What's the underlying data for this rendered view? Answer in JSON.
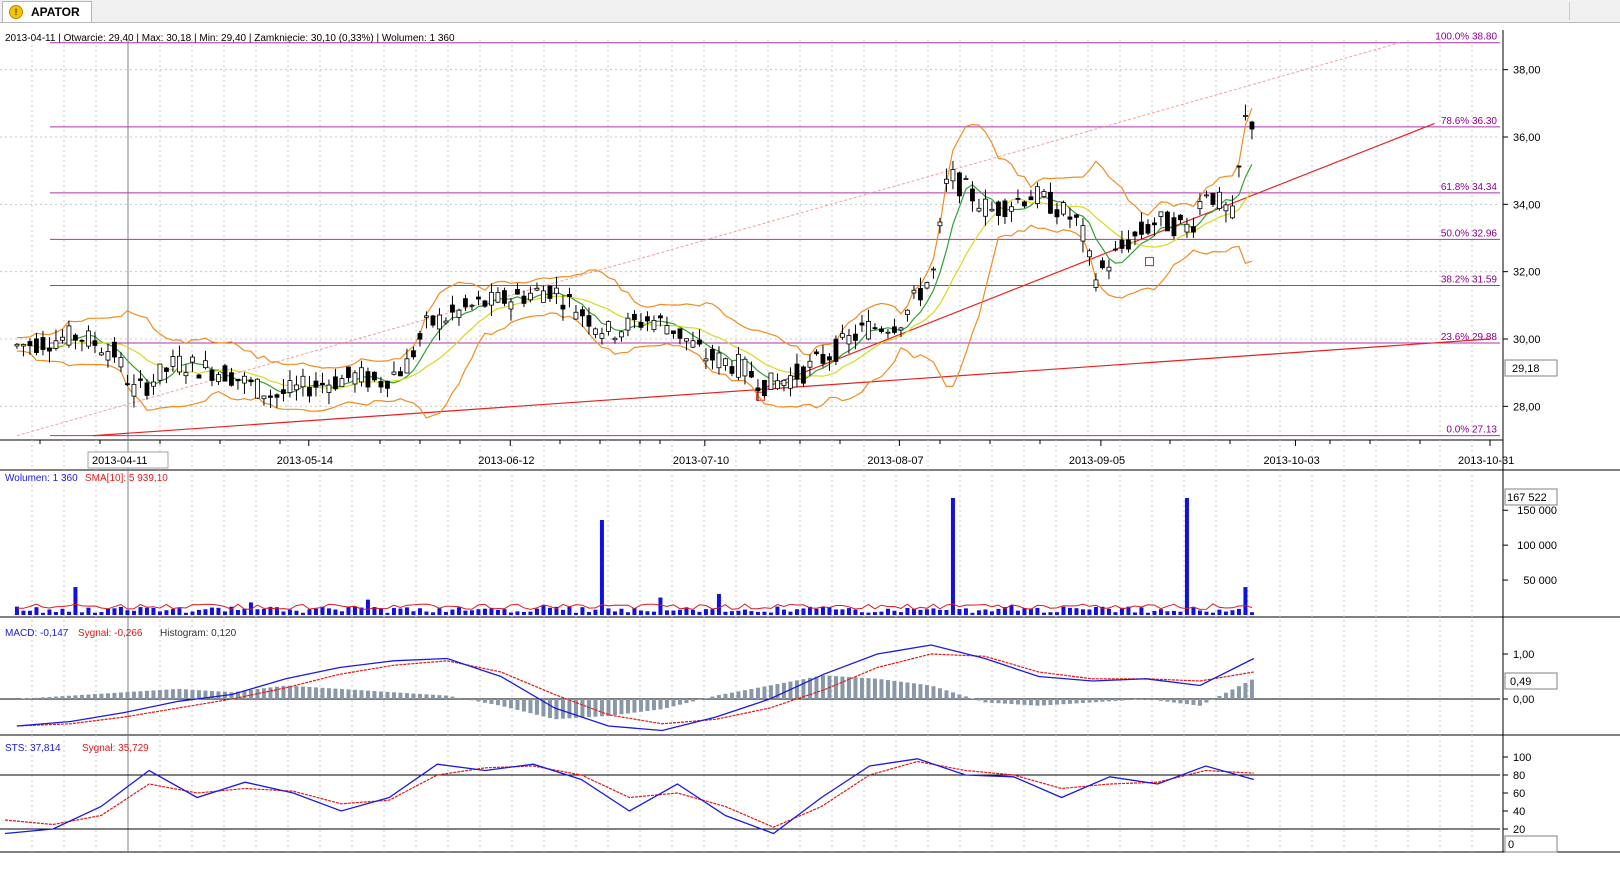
{
  "tab": {
    "icon": "warning-icon",
    "title": "APATOR"
  },
  "header": {
    "info": "2013-04-11 | Otwarcie: 29,40 | Max: 30,18 | Min: 29,40 | Zamknięcie: 30,10 (0,33%)  | Wolumen: 1 360"
  },
  "price_panel": {
    "last_price_label": "29,18",
    "cursor_date_label": "2013-04-11",
    "y_ticks": [
      "28,00",
      "30,00",
      "32,00",
      "34,00",
      "36,00",
      "38,00"
    ],
    "x_ticks": [
      "2013-05-14",
      "2013-06-12",
      "2013-07-10",
      "2013-08-07",
      "2013-09-05",
      "2013-10-03",
      "2013-10-31"
    ],
    "fib_levels": [
      {
        "label": "100.0% 38.80",
        "value": 38.8
      },
      {
        "label": "78.6% 36.30",
        "value": 36.3
      },
      {
        "label": "61.8% 34.34",
        "value": 34.34
      },
      {
        "label": "50.0% 32.96",
        "value": 32.96
      },
      {
        "label": "38.2% 31.59",
        "value": 31.59
      },
      {
        "label": "23.6% 29.88",
        "value": 29.88
      },
      {
        "label": "0.0% 27.13",
        "value": 27.13
      }
    ]
  },
  "volume_panel": {
    "legend_volume": "Wolumen: 1 360",
    "legend_sma": "SMA[10]: 5 939,10",
    "max_label": "167 522",
    "y_ticks": [
      "50 000",
      "100 000",
      "150 000"
    ]
  },
  "macd_panel": {
    "legend_macd": "MACD: -0,147",
    "legend_signal": "Sygnał: -0,266",
    "legend_hist": "Histogram: 0,120",
    "current_label": "0,49",
    "y_ticks": [
      "0,00",
      "1,00"
    ]
  },
  "sts_panel": {
    "legend_sts": "STS: 37,814",
    "legend_signal": "Sygnał: 35,729",
    "current_label": "0",
    "y_ticks": [
      "20",
      "40",
      "60",
      "80",
      "100"
    ]
  },
  "colors": {
    "up": "#ffffff",
    "down": "#000000",
    "fib": "#b030b0",
    "trend": "#e82020",
    "bollinger": "#f08c20",
    "ma_fast": "#30a030",
    "ma_slow": "#d8d820",
    "volume": "#1010e0",
    "macd": "#1a1ae0",
    "signal": "#e01a1a",
    "hist": "#8898a8"
  },
  "chart_data": [
    {
      "type": "candlestick",
      "title": "APATOR",
      "y_range": [
        27.0,
        39.0
      ],
      "x_range": [
        "2013-04-01",
        "2013-10-31"
      ],
      "ohlc_keypoints": [
        [
          "2013-04-02",
          29.8
        ],
        [
          "2013-04-11",
          30.1
        ],
        [
          "2013-04-16",
          29.6
        ],
        [
          "2013-04-19",
          28.4
        ],
        [
          "2013-04-25",
          29.3
        ],
        [
          "2013-05-02",
          29.0
        ],
        [
          "2013-05-09",
          28.3
        ],
        [
          "2013-05-14",
          28.6
        ],
        [
          "2013-05-21",
          28.9
        ],
        [
          "2013-05-24",
          28.7
        ],
        [
          "2013-05-28",
          29.2
        ],
        [
          "2013-05-31",
          30.4
        ],
        [
          "2013-06-07",
          31.0
        ],
        [
          "2013-06-12",
          31.2
        ],
        [
          "2013-06-18",
          31.5
        ],
        [
          "2013-06-21",
          31.0
        ],
        [
          "2013-06-26",
          30.2
        ],
        [
          "2013-07-02",
          30.6
        ],
        [
          "2013-07-05",
          30.4
        ],
        [
          "2013-07-10",
          29.5
        ],
        [
          "2013-07-15",
          29.2
        ],
        [
          "2013-07-19",
          28.6
        ],
        [
          "2013-07-24",
          29.0
        ],
        [
          "2013-07-29",
          29.7
        ],
        [
          "2013-08-02",
          30.3
        ],
        [
          "2013-08-07",
          30.5
        ],
        [
          "2013-08-12",
          32.0
        ],
        [
          "2013-08-14",
          34.9
        ],
        [
          "2013-08-20",
          33.8
        ],
        [
          "2013-08-26",
          34.3
        ],
        [
          "2013-08-29",
          34.0
        ],
        [
          "2013-09-02",
          33.4
        ],
        [
          "2013-09-04",
          31.8
        ],
        [
          "2013-09-09",
          32.9
        ],
        [
          "2013-09-13",
          33.5
        ],
        [
          "2013-09-18",
          33.3
        ],
        [
          "2013-09-20",
          34.5
        ],
        [
          "2013-09-24",
          33.6
        ],
        [
          "2013-09-26",
          36.8
        ],
        [
          "2013-09-27",
          36.3
        ]
      ]
    },
    {
      "type": "bar",
      "title": "Wolumen",
      "y_range": [
        0,
        167522
      ],
      "series": [
        {
          "name": "Wolumen",
          "values": [
            12000,
            40000,
            6000,
            5000,
            18000,
            8000,
            22000,
            5000,
            9000,
            14000,
            136000,
            25000,
            30000,
            12000,
            8000,
            6000,
            174000,
            14000,
            10000,
            12000,
            170000,
            40000,
            18000,
            60000,
            60000,
            28000,
            22000,
            12000
          ]
        }
      ]
    },
    {
      "type": "line",
      "title": "MACD",
      "y_range": [
        -0.8,
        1.2
      ],
      "series": [
        {
          "name": "MACD",
          "values": [
            -0.6,
            -0.5,
            -0.3,
            -0.05,
            0.1,
            0.45,
            0.7,
            0.85,
            0.9,
            0.5,
            -0.2,
            -0.6,
            -0.7,
            -0.4,
            0.0,
            0.55,
            1.0,
            1.2,
            0.9,
            0.5,
            0.4,
            0.45,
            0.3,
            0.9
          ]
        },
        {
          "name": "Sygnał",
          "values": [
            -0.6,
            -0.55,
            -0.4,
            -0.2,
            0.0,
            0.25,
            0.55,
            0.75,
            0.85,
            0.6,
            0.1,
            -0.35,
            -0.55,
            -0.45,
            -0.2,
            0.2,
            0.7,
            1.0,
            0.95,
            0.6,
            0.45,
            0.45,
            0.4,
            0.6
          ]
        }
      ]
    },
    {
      "type": "line",
      "title": "STS",
      "y_range": [
        0,
        100
      ],
      "series": [
        {
          "name": "STS",
          "values": [
            15,
            20,
            45,
            85,
            55,
            72,
            60,
            40,
            55,
            92,
            85,
            92,
            75,
            40,
            70,
            35,
            15,
            55,
            90,
            98,
            80,
            78,
            55,
            78,
            70,
            90,
            75
          ]
        },
        {
          "name": "Sygnał",
          "values": [
            30,
            25,
            35,
            70,
            60,
            65,
            62,
            48,
            52,
            80,
            88,
            90,
            80,
            55,
            60,
            45,
            22,
            45,
            80,
            95,
            85,
            80,
            65,
            70,
            72,
            85,
            82
          ]
        }
      ]
    }
  ]
}
